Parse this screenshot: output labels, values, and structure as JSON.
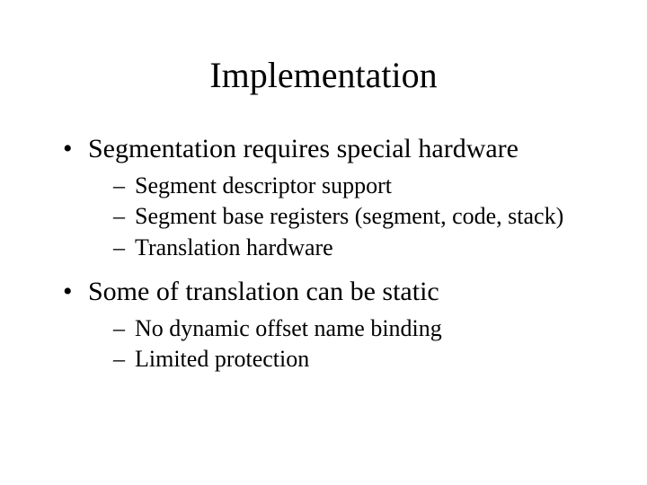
{
  "title": "Implementation",
  "bullets": [
    {
      "text": "Segmentation requires special hardware",
      "sub": [
        "Segment descriptor support",
        "Segment base registers (segment, code, stack)",
        "Translation hardware"
      ]
    },
    {
      "text": "Some of translation can be static",
      "sub": [
        "No dynamic offset name binding",
        "Limited protection"
      ]
    }
  ]
}
